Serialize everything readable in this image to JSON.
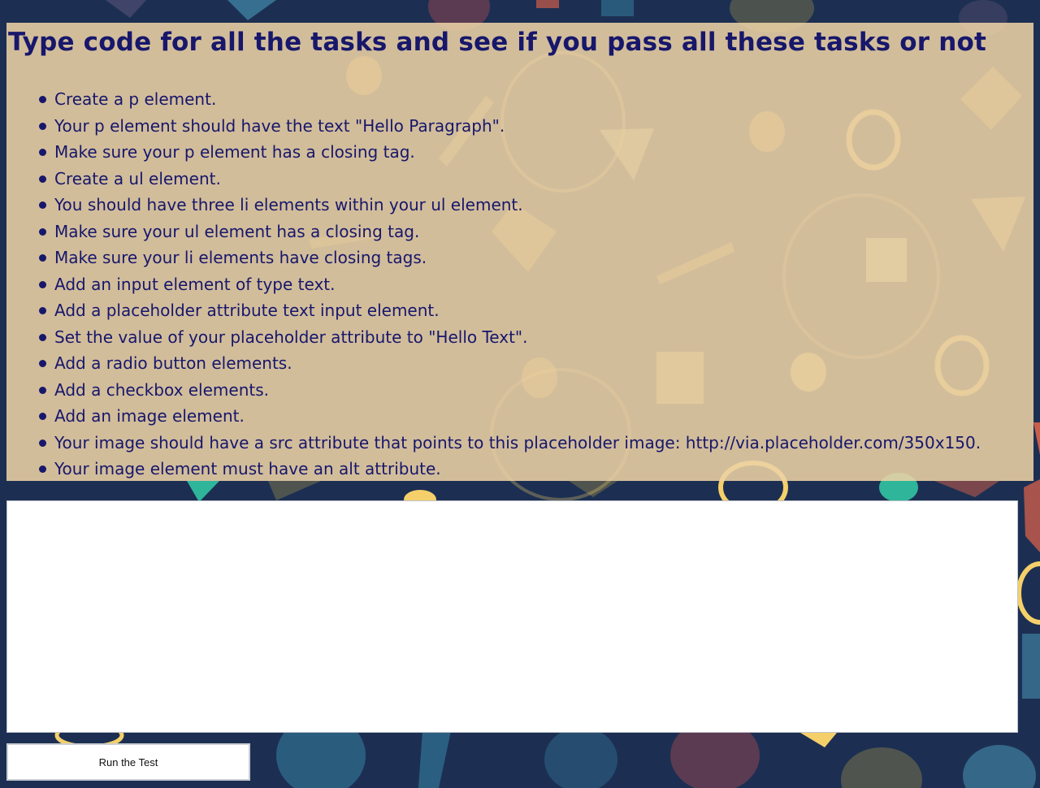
{
  "theme": {
    "background": "#1c2f52",
    "panel": "#ecd2a5",
    "text": "#17176b",
    "shape_colors": [
      "#f2a94b",
      "#f5d06a",
      "#3f7fa0",
      "#2fb59a",
      "#b8584a",
      "#5a5a6a"
    ]
  },
  "task_panel": {
    "title": "Type code for all the tasks and see if you pass all these tasks or not",
    "tasks": [
      "Create a p element.",
      "Your p element should have the text \"Hello Paragraph\".",
      "Make sure your p element has a closing tag.",
      "Create a ul element.",
      "You should have three li elements within your ul element.",
      "Make sure your ul element has a closing tag.",
      "Make sure your li elements have closing tags.",
      "Add an input element of type text.",
      "Add a placeholder attribute text input element.",
      "Set the value of your placeholder attribute to \"Hello Text\".",
      "Add a radio button elements.",
      "Add a checkbox elements.",
      "Add an image element.",
      "Your image should have a src attribute that points to this placeholder image: http://via.placeholder.com/350x150.",
      "Your image element must have an alt attribute."
    ]
  },
  "editor": {
    "value": ""
  },
  "run_button": {
    "label": "Run the Test"
  }
}
